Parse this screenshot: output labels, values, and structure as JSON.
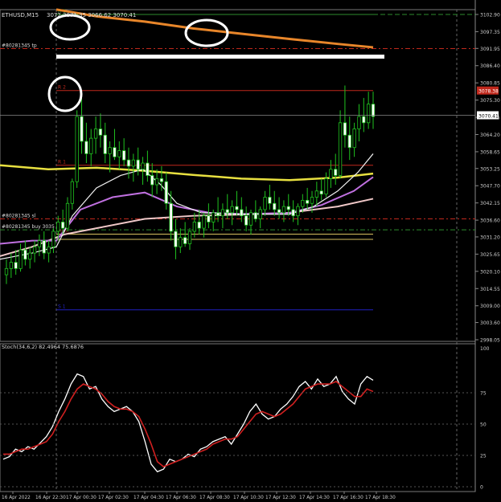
{
  "header": {
    "symbol_label": "ETHUSD,M15",
    "ohlc_text": "3072 3071.35 3066.62 3070.41"
  },
  "chart_data": {
    "type": "candlestick",
    "price_axis": {
      "ticks": [
        "3102.90",
        "3097.35",
        "3091.95",
        "3086.40",
        "3080.85",
        "3075.30",
        "3069.75",
        "3064.20",
        "3058.65",
        "3053.25",
        "3047.70",
        "3042.15",
        "3036.60",
        "3031.20",
        "3025.65",
        "3020.10",
        "3014.55",
        "3009.00",
        "3003.60",
        "2998.05"
      ],
      "current_price_label": "3070.41",
      "red_price_label": "3078.38"
    },
    "time_axis": {
      "labels": [
        "16 Apr 2022",
        "16 Apr 22:30",
        "17 Apr 00:30",
        "17 Apr 02:30",
        "17 Apr 04:30",
        "17 Apr 06:30",
        "17 Apr 08:30",
        "17 Apr 10:30",
        "17 Apr 12:30",
        "17 Apr 14:30",
        "17 Apr 16:30",
        "17 Apr 18:30"
      ]
    },
    "levels": [
      {
        "label": "R 3",
        "price": 3102.9,
        "color": "#2e8b2e"
      },
      {
        "label": "R 2",
        "price": 3078.38,
        "color": "#c0281c"
      },
      {
        "label": "R 1",
        "price": 3054.3,
        "color": "#c0281c"
      },
      {
        "label": "S 1",
        "price": 3007.7,
        "color": "#2020c0"
      },
      {
        "label": "#80281345 tp",
        "price": 3091.9,
        "color": "#c0281c"
      },
      {
        "label": "#80281345 sl",
        "price": 3037.0,
        "color": "#c0281c"
      },
      {
        "label": "#80281345 buy 3035",
        "price": 3033.5,
        "color": "#2e8b2e"
      }
    ],
    "extra_label": "Pivot",
    "oscillator": {
      "title": "Stoch(34,6,2) 82.4964 75.6876",
      "ticks": [
        "100",
        "75",
        "50",
        "25",
        "0"
      ]
    },
    "annotations": [
      "circle-r3",
      "circle-ma",
      "circle-r2"
    ]
  }
}
